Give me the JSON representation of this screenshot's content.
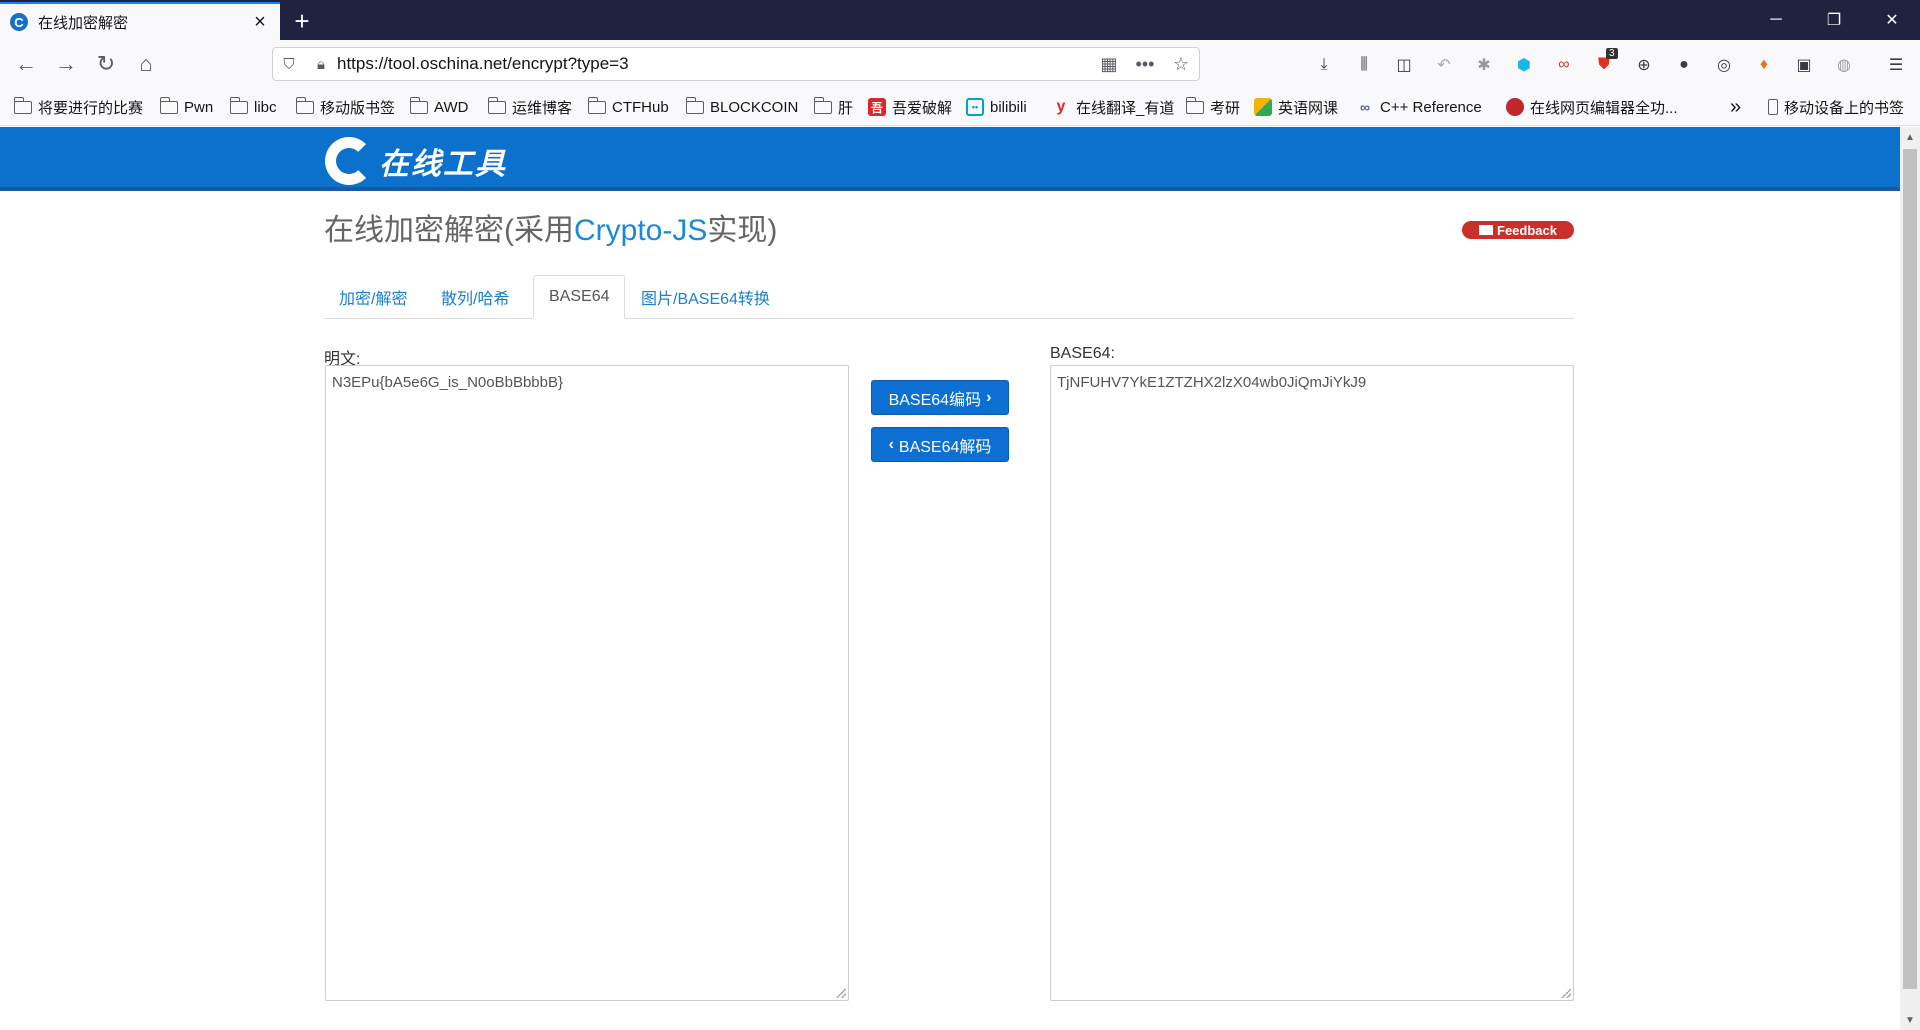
{
  "browser": {
    "tab_title": "在线加密解密",
    "tab_favicon": "C",
    "url": "https://tool.oschina.net/encrypt?type=3",
    "ext_badge": "3"
  },
  "bookmarks": [
    {
      "label": "将要进行的比赛",
      "icon": "folder-icon"
    },
    {
      "label": "Pwn",
      "icon": "folder-icon"
    },
    {
      "label": "libc",
      "icon": "folder-icon"
    },
    {
      "label": "移动版书签",
      "icon": "folder-icon"
    },
    {
      "label": "AWD",
      "icon": "folder-icon"
    },
    {
      "label": "运维博客",
      "icon": "folder-icon"
    },
    {
      "label": "CTFHub",
      "icon": "folder-icon"
    },
    {
      "label": "BLOCKCOIN",
      "icon": "folder-icon"
    },
    {
      "label": "肝",
      "icon": "folder-icon"
    },
    {
      "label": "吾爱破解",
      "icon": "52pojie-icon"
    },
    {
      "label": "bilibili",
      "icon": "bilibili-icon"
    },
    {
      "label": "在线翻译_有道",
      "icon": "youdao-icon"
    },
    {
      "label": "考研",
      "icon": "folder-icon"
    },
    {
      "label": "英语网课",
      "icon": "english-icon"
    },
    {
      "label": "C++ Reference",
      "icon": "cpp-icon"
    },
    {
      "label": "在线网页编辑器全功...",
      "icon": "editor-icon"
    },
    {
      "label": "移动设备上的书签",
      "icon": "mobile-icon"
    }
  ],
  "site": {
    "logo_text": "在线工具",
    "title_prefix": "在线加密解密(采用",
    "title_highlight": "Crypto-JS",
    "title_suffix": "实现)",
    "feedback": "Feedback",
    "tabs": [
      "加密/解密",
      "散列/哈希",
      "BASE64",
      "图片/BASE64转换"
    ],
    "active_tab": "BASE64"
  },
  "form": {
    "plain_label": "明文:",
    "plain_value": "N3EPu{bA5e6G_is_N0oBbBbbbB}",
    "base64_label": "BASE64:",
    "base64_value": "TjNFUHV7YkE1ZTZHX2lzX04wb0JiQmJiYkJ9",
    "encode_button": "BASE64编码",
    "decode_button": "BASE64解码"
  },
  "colors": {
    "header_blue": "#0c71cc",
    "button_blue": "#0c6fd1",
    "link_blue": "#1a7fcc",
    "feedback_red": "#c9302c"
  }
}
